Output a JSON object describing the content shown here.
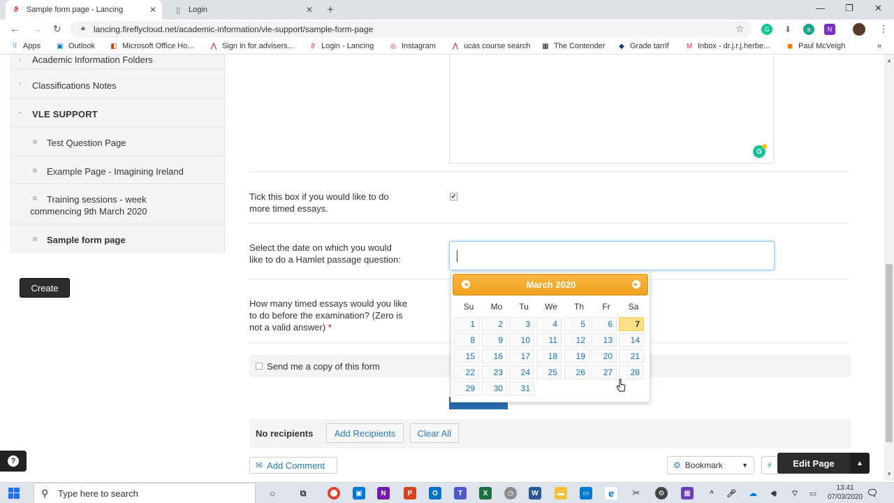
{
  "browser": {
    "tabs": [
      {
        "title": "Sample form page - Lancing",
        "active": true
      },
      {
        "title": "Login",
        "active": false
      }
    ],
    "url": "lancing.fireflycloud.net/academic-information/vle-support/sample-form-page",
    "bookmarks": [
      "Apps",
      "Outlook",
      "Microsoft Office Ho...",
      "Sign in for advisers...",
      "Login - Lancing",
      "Instagram",
      "ucas course search",
      "The Contender",
      "Grade tarrif",
      "Inbox - dr.j.r.j.herbe...",
      "Paul McVeigh"
    ]
  },
  "sidebar": {
    "items": [
      {
        "label": "Academic Information Folders",
        "kind": "chevron"
      },
      {
        "label": "Classifications Notes",
        "kind": "chevron"
      },
      {
        "label": "VLE SUPPORT",
        "kind": "section"
      },
      {
        "label": "Test Question Page",
        "kind": "bullet"
      },
      {
        "label": "Example Page - Imagining Ireland",
        "kind": "bullet"
      },
      {
        "label_line1": "Training sessions - week",
        "label_line2": "commencing 9th March 2020",
        "kind": "bullet"
      },
      {
        "label": "Sample form page",
        "kind": "bullet-current"
      }
    ],
    "create_label": "Create"
  },
  "form": {
    "checkbox_question_line1": "Tick this box if you would like to do",
    "checkbox_question_line2": "more timed essays.",
    "date_question_line1": "Select the date on which you would",
    "date_question_line2": "like to do a Hamlet passage question:",
    "essays_question_line1": "How many timed essays would you like",
    "essays_question_line2": "to do before the examination? (Zero is",
    "essays_question_line3": "not a valid answer)",
    "required_mark": "*",
    "send_copy_label": "Send me a copy of this form",
    "no_recipients": "No recipients",
    "add_recipients": "Add Recipients",
    "clear_all": "Clear All"
  },
  "datepicker": {
    "title": "March 2020",
    "dow": [
      "Su",
      "Mo",
      "Tu",
      "We",
      "Th",
      "Fr",
      "Sa"
    ],
    "weeks": [
      [
        "1",
        "2",
        "3",
        "4",
        "5",
        "6",
        "7"
      ],
      [
        "8",
        "9",
        "10",
        "11",
        "12",
        "13",
        "14"
      ],
      [
        "15",
        "16",
        "17",
        "18",
        "19",
        "20",
        "21"
      ],
      [
        "22",
        "23",
        "24",
        "25",
        "26",
        "27",
        "28"
      ],
      [
        "29",
        "30",
        "31",
        "",
        "",
        "",
        ""
      ]
    ],
    "highlighted": "7",
    "highlight_color": "#fbe089",
    "header_color": "#f0a020"
  },
  "footer": {
    "add_comment": "Add Comment",
    "bookmark": "Bookmark",
    "edit_page": "Edit Page"
  },
  "taskbar": {
    "search_placeholder": "Type here to search",
    "time": "13:41",
    "date": "07/03/2020"
  }
}
